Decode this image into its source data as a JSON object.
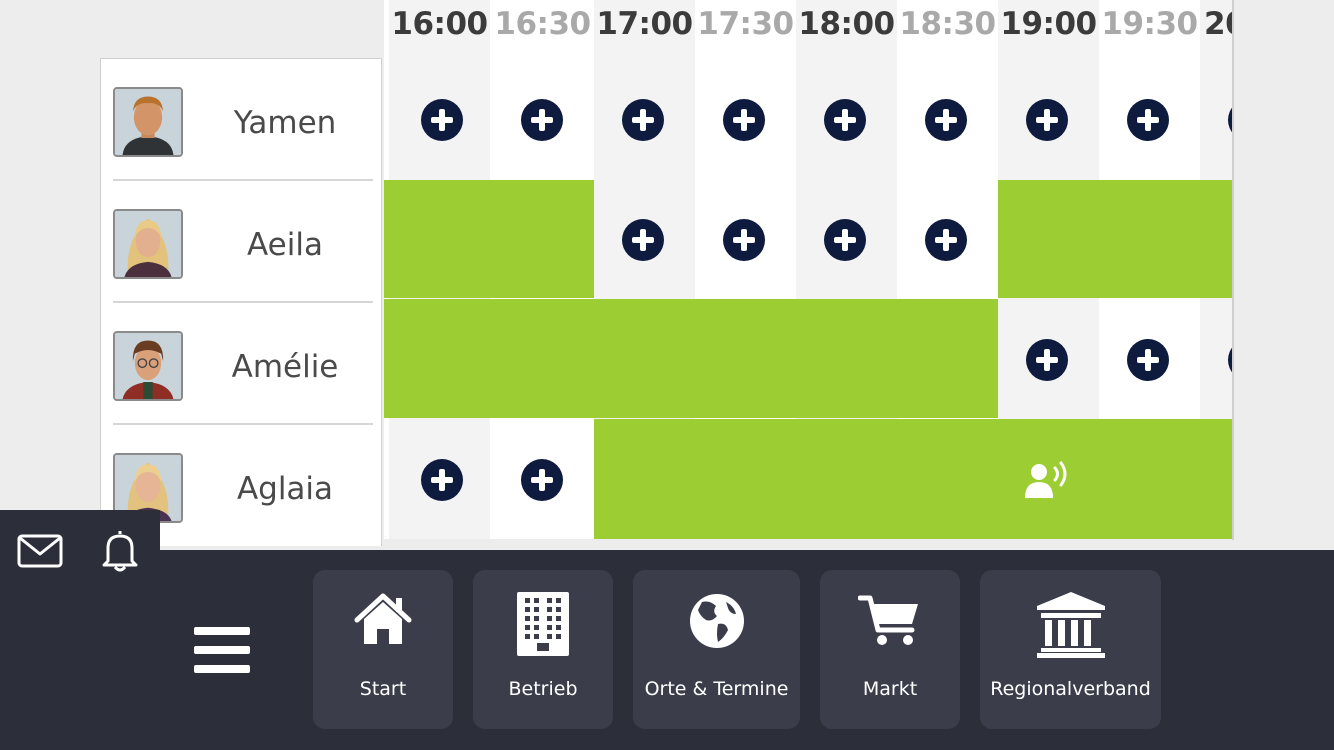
{
  "staff": [
    {
      "name": "Yamen"
    },
    {
      "name": "Aeila"
    },
    {
      "name": "Amélie"
    },
    {
      "name": "Aglaia"
    }
  ],
  "schedule": {
    "times": [
      "16:00",
      "16:30",
      "17:00",
      "17:30",
      "18:00",
      "18:30",
      "19:00",
      "19:30",
      "20"
    ],
    "busy_color": "#9ccd33",
    "add_button_color": "#0e1a3e"
  },
  "nav": {
    "items": [
      {
        "label": "Start",
        "icon": "home-icon"
      },
      {
        "label": "Betrieb",
        "icon": "office-building-icon"
      },
      {
        "label": "Orte & Termine",
        "icon": "globe-icon"
      },
      {
        "label": "Markt",
        "icon": "shopping-cart-icon"
      },
      {
        "label": "Regionalverband",
        "icon": "institution-icon"
      }
    ],
    "bar_color": "#2c2f3a"
  },
  "notifications": {
    "icons": [
      "mail-icon",
      "bell-icon"
    ]
  }
}
